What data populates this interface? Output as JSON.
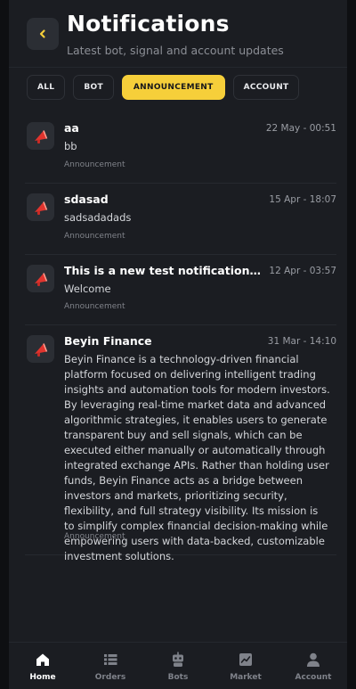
{
  "header": {
    "title": "Notifications",
    "subtitle": "Latest bot, signal and account updates"
  },
  "filters": [
    {
      "label": "ALL",
      "active": false
    },
    {
      "label": "BOT",
      "active": false
    },
    {
      "label": "ANNOUNCEMENT",
      "active": true
    },
    {
      "label": "ACCOUNT",
      "active": false
    }
  ],
  "notifications": [
    {
      "title": "aa",
      "time": "22 May - 00:51",
      "body": "bb",
      "tag": "Announcement"
    },
    {
      "title": "sdasad",
      "time": "15 Apr - 18:07",
      "body": "sadsadadads",
      "tag": "Announcement"
    },
    {
      "title": "This is a new test notification! Click...",
      "time": "12 Apr - 03:57",
      "body": "Welcome",
      "tag": "Announcement"
    },
    {
      "title": "Beyin Finance",
      "time": "31 Mar - 14:10",
      "body": "Beyin Finance is a technology-driven financial platform focused on delivering intelligent trading insights and automation tools for modern investors. By leveraging real-time market data and advanced algorithmic strategies, it enables users to generate transparent buy and sell signals, which can be executed either manually or automatically through integrated exchange APIs. Rather than holding user funds, Beyin Finance acts as a bridge between investors and markets, prioritizing security, flexibility, and full strategy visibility. Its mission is to simplify complex financial decision-making while empowering users with data-backed, customizable investment solutions.",
      "tag": "Announcement"
    }
  ],
  "nav": {
    "home": "Home",
    "orders": "Orders",
    "bots": "Bots",
    "market": "Market",
    "account": "Account",
    "active": "home"
  },
  "colors": {
    "accent": "#f6cf3a",
    "background": "#1b1d22",
    "card": "#2b2e34",
    "announcement_icon": "#e0342e"
  },
  "icons": {
    "back": "chevron-left-icon",
    "announcement": "megaphone-icon",
    "home": "home-icon",
    "orders": "list-icon",
    "bots": "robot-icon",
    "market": "chart-icon",
    "account": "user-icon"
  }
}
